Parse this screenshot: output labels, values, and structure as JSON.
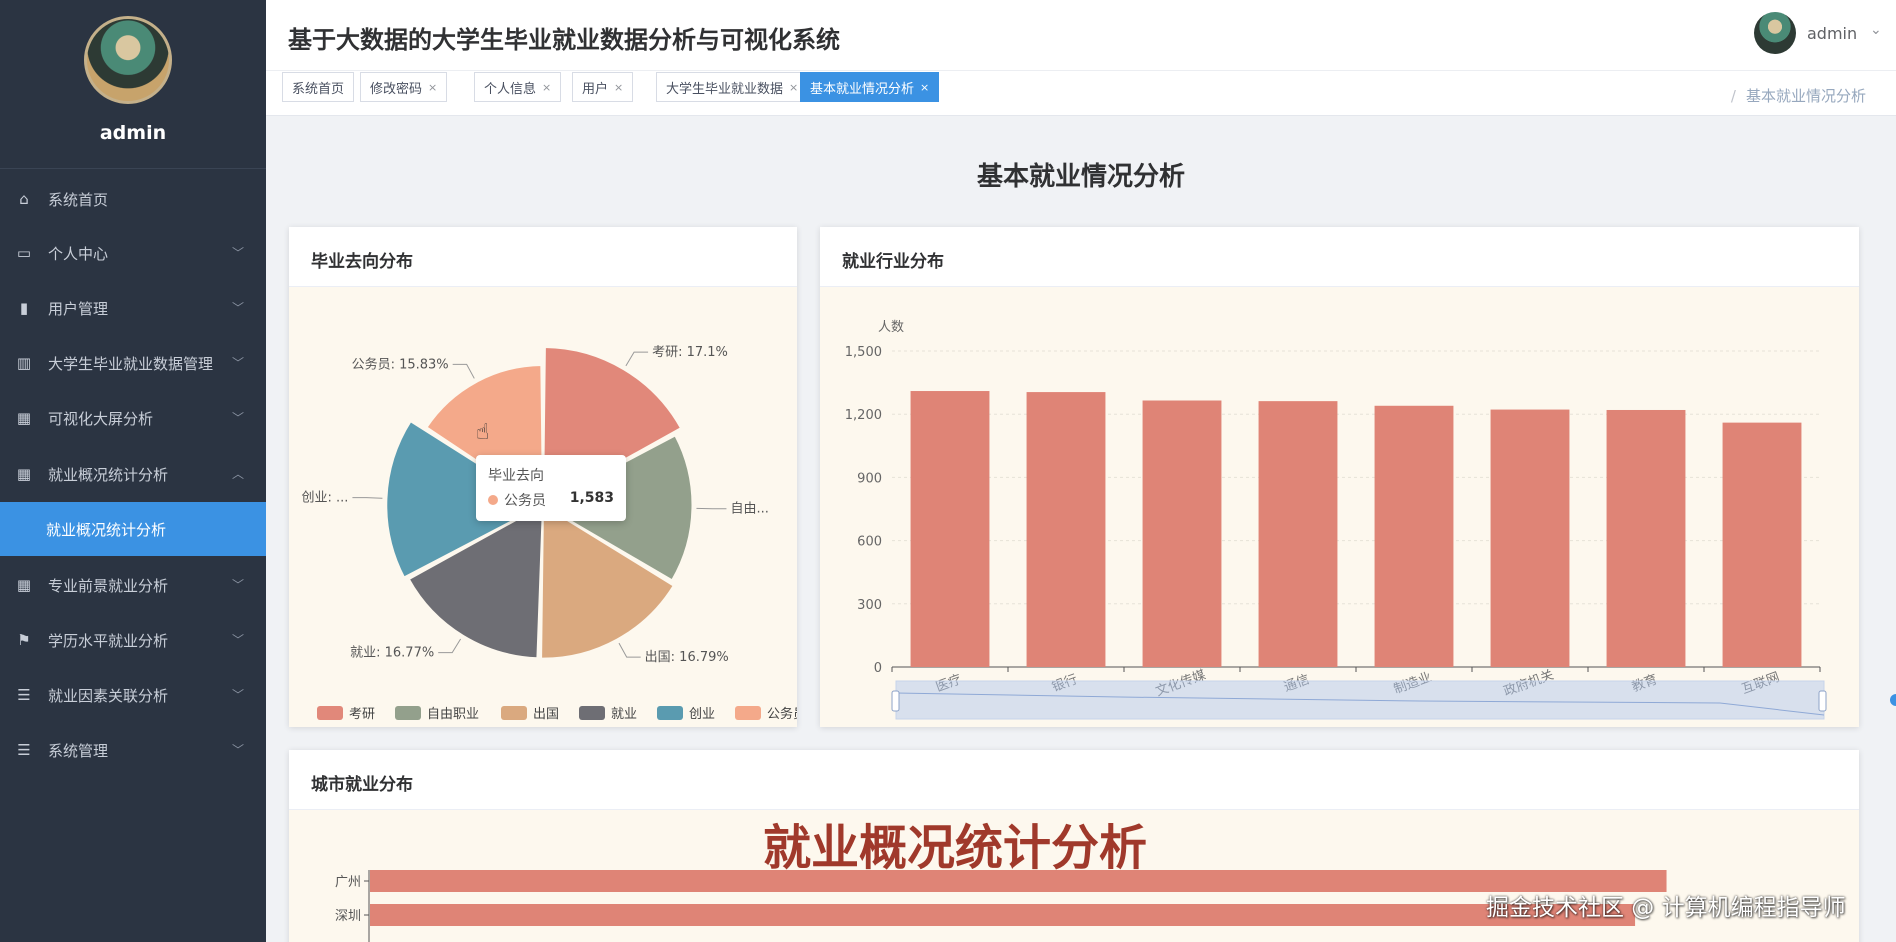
{
  "sidebar": {
    "username": "admin",
    "items": [
      {
        "label": "系统首页",
        "icon": "home-icon",
        "glyph": "⌂",
        "expandable": false
      },
      {
        "label": "个人中心",
        "icon": "card-icon",
        "glyph": "▭",
        "expandable": true
      },
      {
        "label": "用户管理",
        "icon": "book-icon",
        "glyph": "▮",
        "expandable": true
      },
      {
        "label": "大学生毕业就业数据管理",
        "icon": "bar-chart-icon",
        "glyph": "▥",
        "expandable": true
      },
      {
        "label": "可视化大屏分析",
        "icon": "grid-icon",
        "glyph": "▦",
        "expandable": true
      },
      {
        "label": "就业概况统计分析",
        "icon": "grid-icon",
        "glyph": "▦",
        "expandable": true,
        "expanded": true
      },
      {
        "label": "专业前景就业分析",
        "icon": "grid-icon",
        "glyph": "▦",
        "expandable": true
      },
      {
        "label": "学历水平就业分析",
        "icon": "flag-icon",
        "glyph": "⚑",
        "expandable": true
      },
      {
        "label": "就业因素关联分析",
        "icon": "sliders-icon",
        "glyph": "☰",
        "expandable": true
      },
      {
        "label": "系统管理",
        "icon": "list-icon",
        "glyph": "☰",
        "expandable": true
      }
    ],
    "active_sub_item": "就业概况统计分析"
  },
  "header": {
    "title": "基于大数据的大学生毕业就业数据分析与可视化系统",
    "user": "admin"
  },
  "tabs": [
    {
      "label": "系统首页",
      "closable": false
    },
    {
      "label": "修改密码",
      "closable": true
    },
    {
      "label": "个人信息",
      "closable": true
    },
    {
      "label": "用户",
      "closable": true
    },
    {
      "label": "大学生毕业就业数据",
      "closable": true
    },
    {
      "label": "基本就业情况分析",
      "closable": true,
      "active": true
    }
  ],
  "breadcrumb": {
    "separator": "/",
    "current": "基本就业情况分析"
  },
  "page_heading": "基本就业情况分析",
  "cards": {
    "destination": "毕业去向分布",
    "industry": "就业行业分布",
    "city": "城市就业分布"
  },
  "tooltip": {
    "title": "毕业去向",
    "label": "公务员",
    "value": "1,583",
    "color": "#f4a98a"
  },
  "overlay_title": "就业概况统计分析",
  "watermark": "掘金技术社区 @ 计算机编程指导师",
  "chart_data": [
    {
      "type": "pie",
      "title": "毕业去向分布",
      "rose": true,
      "labels": [
        "考研",
        "自由职业",
        "出国",
        "就业",
        "创业",
        "公务员"
      ],
      "percent": [
        17.1,
        16.5,
        16.79,
        16.77,
        17.01,
        15.83
      ],
      "value_labels": [
        "考研: 17.1%",
        "自由...",
        "出国: 16.79%",
        "就业: 16.77%",
        "创业: ...",
        "公务员: 15.83%"
      ],
      "colors": [
        "#e1887a",
        "#93a08c",
        "#daa97f",
        "#6e6e74",
        "#5a9bb0",
        "#f4a98a"
      ],
      "legend": "bottom"
    },
    {
      "type": "bar",
      "title": "就业行业分布",
      "ylabel": "人数",
      "ylim": [
        0,
        1500
      ],
      "yticks": [
        0,
        300,
        600,
        900,
        1200,
        1500
      ],
      "ytick_labels": [
        "0",
        "300",
        "600",
        "900",
        "1,200",
        "1,500"
      ],
      "categories": [
        "医疗",
        "银行",
        "文化传媒",
        "通信",
        "制造业",
        "政府机关",
        "教育",
        "互联网"
      ],
      "values": [
        1310,
        1305,
        1265,
        1262,
        1240,
        1222,
        1220,
        1160
      ],
      "color": "#df8476",
      "grid": true,
      "datazoom": true
    },
    {
      "type": "bar",
      "orientation": "horizontal",
      "title": "城市就业分布",
      "categories": [
        "广州",
        "深圳"
      ],
      "values": [
        1360,
        1327
      ],
      "xlim": [
        0,
        1500
      ],
      "color": "#df8476"
    }
  ]
}
